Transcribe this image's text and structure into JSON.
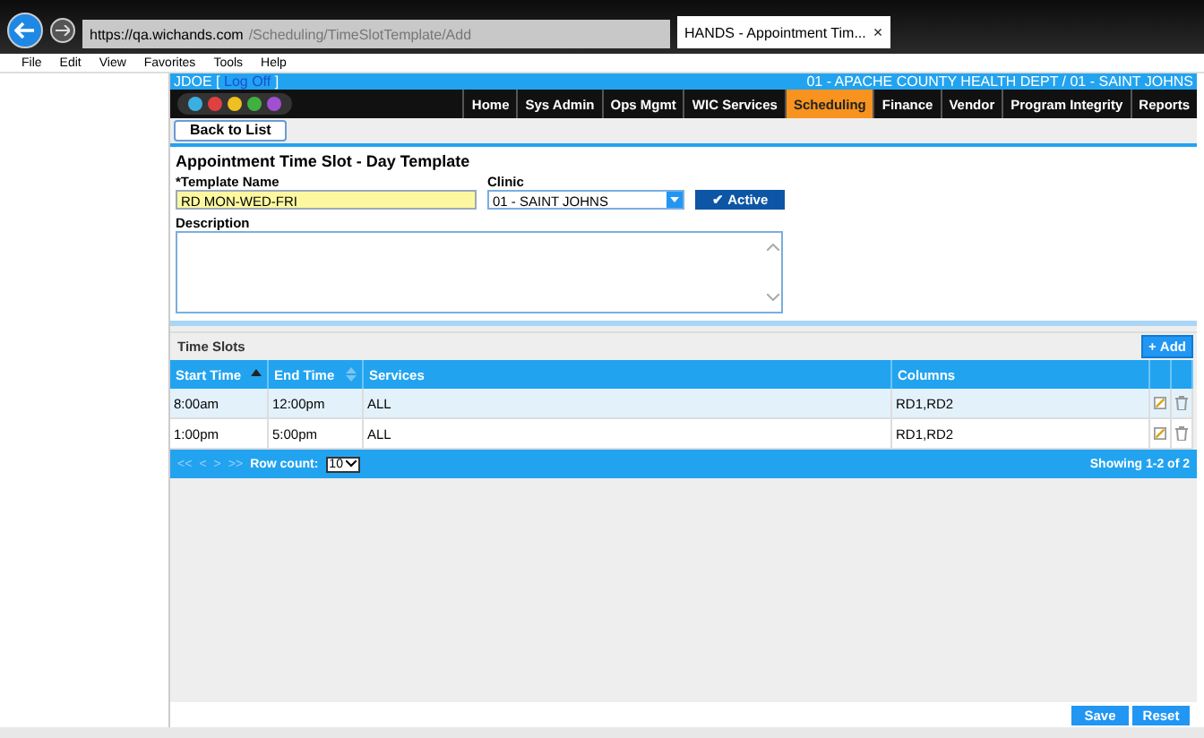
{
  "browser": {
    "url_host": "https://qa.wichands.com",
    "url_path": "/Scheduling/TimeSlotTemplate/Add",
    "tab_title": "HANDS - Appointment Tim...",
    "tab_close": "×",
    "menu": [
      "File",
      "Edit",
      "View",
      "Favorites",
      "Tools",
      "Help"
    ]
  },
  "user_bar": {
    "user": "JDOE [",
    "logoff": "Log Off",
    "close_bracket": "]",
    "location": "01 - APACHE COUNTY HEALTH DEPT / 01 - SAINT JOHNS"
  },
  "nav": [
    {
      "label": "Home",
      "selected": false
    },
    {
      "label": "Sys Admin",
      "selected": false
    },
    {
      "label": "Ops Mgmt",
      "selected": false
    },
    {
      "label": "WIC Services",
      "selected": false
    },
    {
      "label": "Scheduling",
      "selected": true
    },
    {
      "label": "Finance",
      "selected": false
    },
    {
      "label": "Vendor",
      "selected": false
    },
    {
      "label": "Program Integrity",
      "selected": false
    },
    {
      "label": "Reports",
      "selected": false
    }
  ],
  "back_button": "Back to List",
  "form": {
    "title": "Appointment Time Slot - Day Template",
    "template_label": "*Template Name",
    "template_value": "RD MON-WED-FRI",
    "clinic_label": "Clinic",
    "clinic_value": "01 - SAINT JOHNS",
    "active": {
      "icon": "✔",
      "label": "Active",
      "checked": true
    },
    "description_label": "Description"
  },
  "time_slots": {
    "title": "Time Slots",
    "add_icon": "+",
    "add": "Add",
    "columns": [
      {
        "label": "Start Time",
        "sorted": true
      },
      {
        "label": "End Time",
        "sorted": false
      },
      {
        "label": "Services"
      },
      {
        "label": "Columns"
      }
    ],
    "rows": [
      {
        "cells": [
          "8:00am",
          "12:00pm",
          "ALL",
          "RD1,RD2"
        ],
        "selected": true
      },
      {
        "cells": [
          "1:00pm",
          "5:00pm",
          "ALL",
          "RD1,RD2"
        ],
        "selected": false
      }
    ],
    "pager": {
      "first": "<<",
      "prev": "<",
      "next": ">",
      "last": ">>",
      "row_count_label": "Row count:",
      "row_count": "10",
      "showing": "Showing 1-2 of 2"
    }
  },
  "buttons": [
    "Save",
    "Reset"
  ]
}
